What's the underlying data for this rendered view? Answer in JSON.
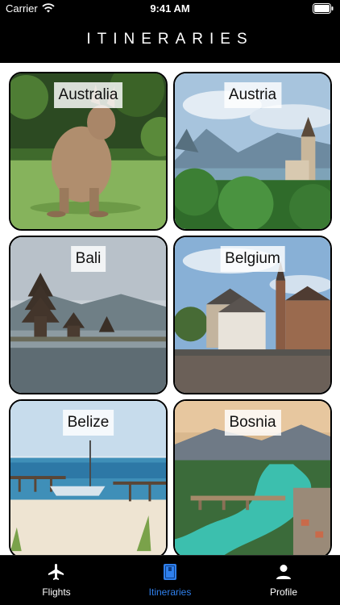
{
  "status_bar": {
    "carrier": "Carrier",
    "time": "9:41 AM"
  },
  "header": {
    "title": "ITINERARIES"
  },
  "destinations": [
    {
      "label": "Australia"
    },
    {
      "label": "Austria"
    },
    {
      "label": "Bali"
    },
    {
      "label": "Belgium"
    },
    {
      "label": "Belize"
    },
    {
      "label": "Bosnia"
    }
  ],
  "tab_bar": {
    "tabs": [
      {
        "label": "Flights",
        "icon": "airplane-icon"
      },
      {
        "label": "Itineraries",
        "icon": "book-icon",
        "active": true
      },
      {
        "label": "Profile",
        "icon": "person-icon"
      }
    ],
    "active_color": "#2f80ed"
  }
}
